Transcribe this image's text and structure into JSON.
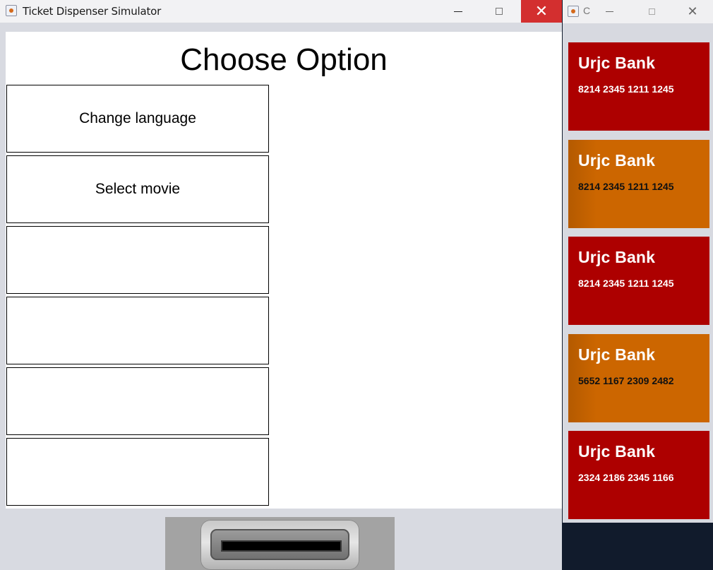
{
  "main_window": {
    "title": "Ticket Dispenser Simulator",
    "heading": "Choose Option",
    "options": [
      {
        "label": "Change language"
      },
      {
        "label": "Select movie"
      },
      {
        "label": ""
      },
      {
        "label": ""
      },
      {
        "label": ""
      },
      {
        "label": ""
      }
    ],
    "controls": {
      "minimize": "minimize-icon",
      "maximize": "maximize-icon",
      "close": "close-icon",
      "close_color": "#d32f2f"
    }
  },
  "wallet_window": {
    "title_truncated": "C",
    "cards": [
      {
        "bank": "Urjc Bank",
        "number": "8214 2345 1211 1245",
        "color": "#ad0000"
      },
      {
        "bank": "Urjc Bank",
        "number": "8214 2345 1211 1245",
        "color": "#cc6600"
      },
      {
        "bank": "Urjc Bank",
        "number": "8214 2345 1211 1245",
        "color": "#ad0000"
      },
      {
        "bank": "Urjc Bank",
        "number": "5652 1167 2309 2482",
        "color": "#cc6600"
      },
      {
        "bank": "Urjc Bank",
        "number": "2324 2186 2345 1166",
        "color": "#ad0000"
      }
    ]
  }
}
